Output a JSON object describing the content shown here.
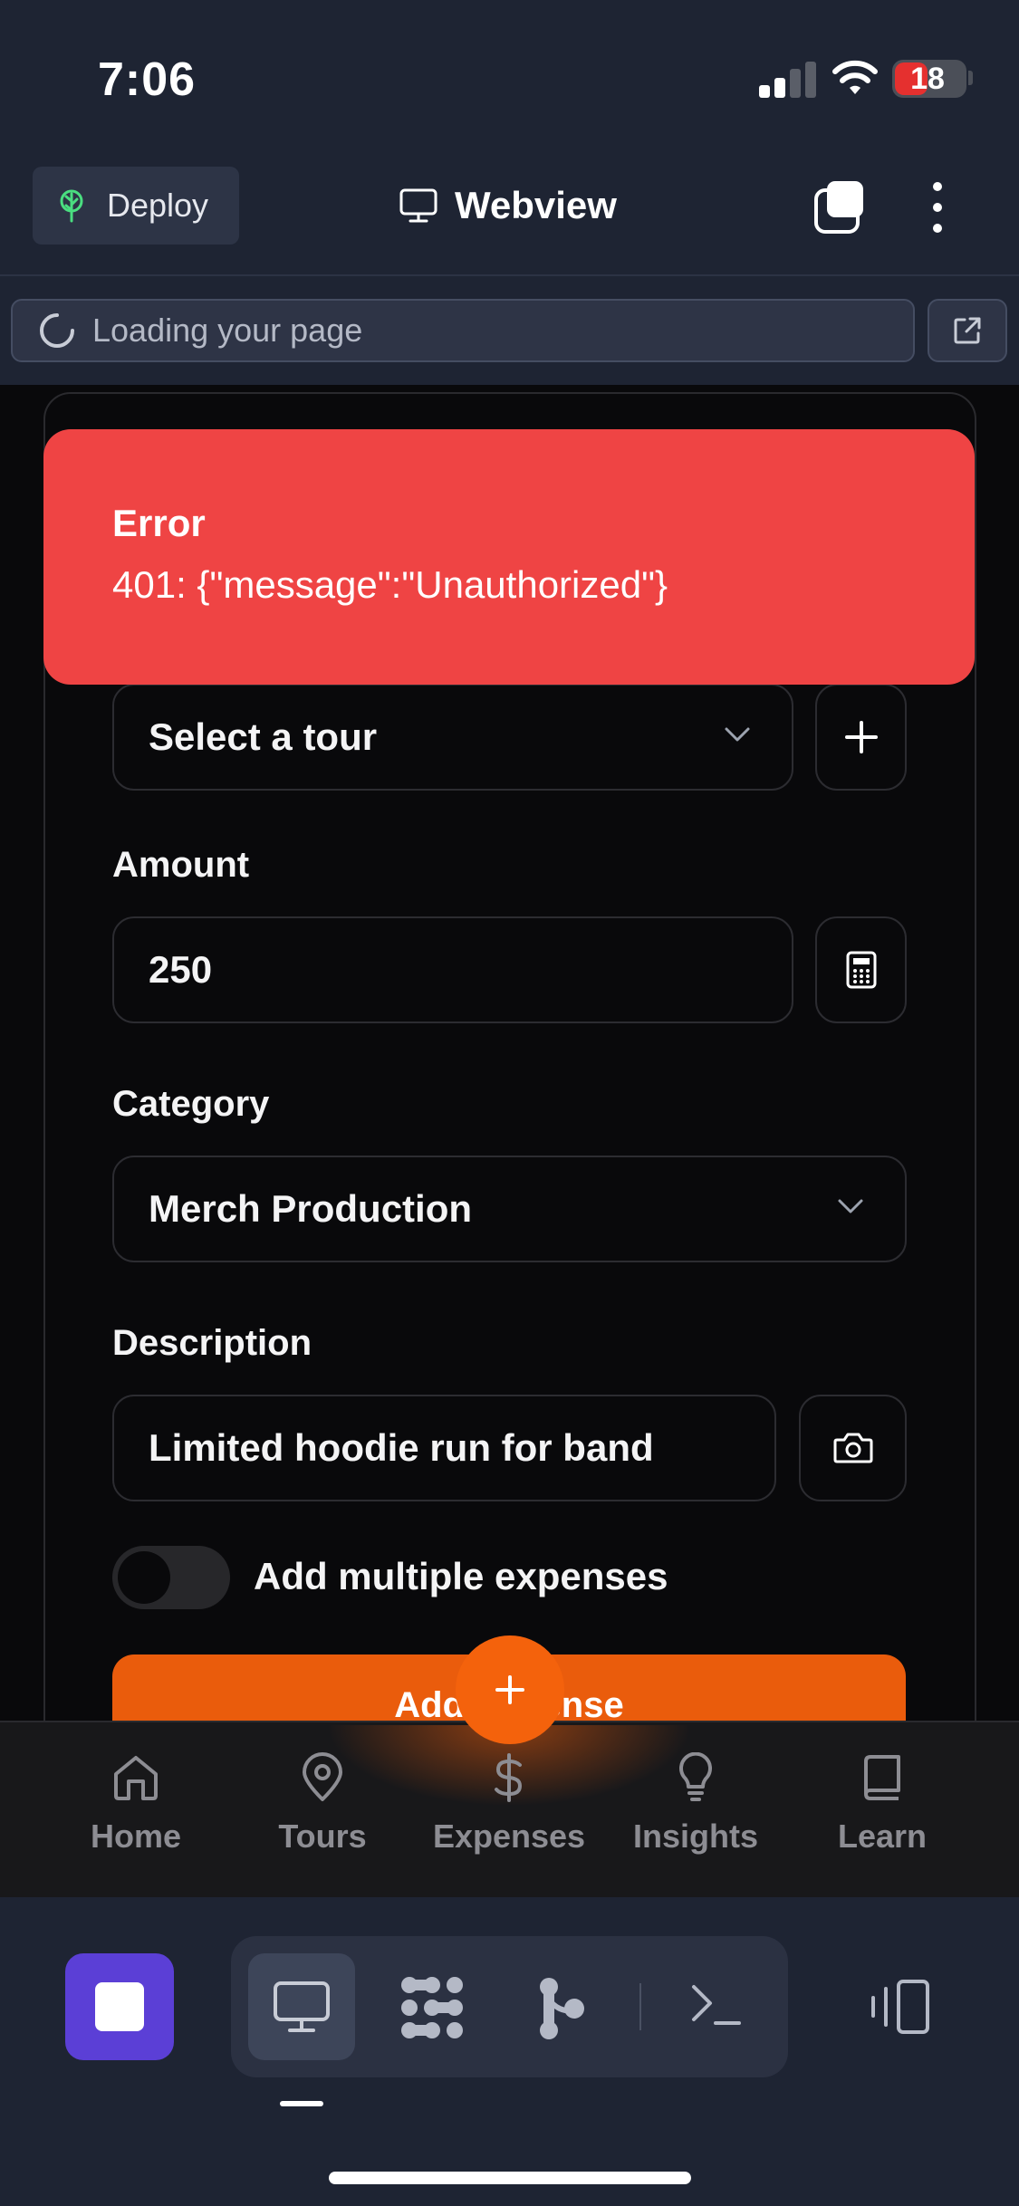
{
  "status_bar": {
    "time": "7:06",
    "battery": "18"
  },
  "toolbar": {
    "deploy_label": "Deploy",
    "title": "Webview"
  },
  "url_bar": {
    "text": "Loading your page"
  },
  "form": {
    "tour_select": {
      "value": "Select a tour"
    },
    "amount": {
      "label": "Amount",
      "value": "250"
    },
    "category": {
      "label": "Category",
      "value": "Merch Production"
    },
    "description": {
      "label": "Description",
      "value": "Limited hoodie run for band"
    },
    "multiple_toggle": {
      "label": "Add multiple expenses",
      "on": false
    },
    "submit_label": "Add Expense"
  },
  "toast": {
    "title": "Error",
    "message": "401: {\"message\":\"Unauthorized\"}"
  },
  "nav": {
    "items": [
      {
        "label": "Home",
        "icon": "home-icon"
      },
      {
        "label": "Tours",
        "icon": "map-pin-icon"
      },
      {
        "label": "Expenses",
        "icon": "dollar-icon"
      },
      {
        "label": "Insights",
        "icon": "lightbulb-icon"
      },
      {
        "label": "Learn",
        "icon": "book-icon"
      }
    ],
    "active_index": 2
  },
  "colors": {
    "accent": "#ea5c0c",
    "error": "#ef4444",
    "dev_stop": "#5b3fd6",
    "deploy_icon": "#4ade80"
  }
}
